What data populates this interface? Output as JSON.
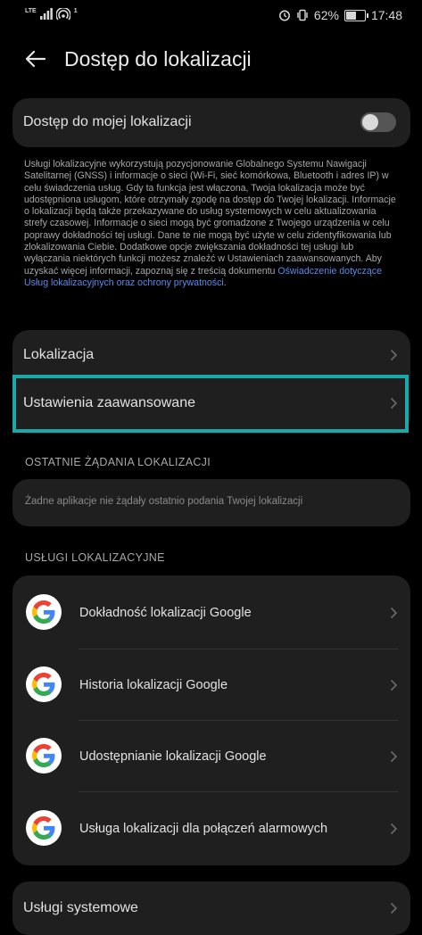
{
  "status": {
    "network": "LTE",
    "signal_sub": "1",
    "battery": "62%",
    "battery_level": 0.62,
    "time": "17:48"
  },
  "header": {
    "title": "Dostęp do lokalizacji"
  },
  "toggle": {
    "label": "Dostęp do mojej lokalizacji",
    "on": false
  },
  "description": {
    "text": "Usługi lokalizacyjne wykorzystują pozycjonowanie Globalnego Systemu Nawigacji Satelitarnej (GNSS) i informacje o sieci (Wi-Fi, sieć komórkowa, Bluetooth i adres IP) w celu świadczenia usług. Gdy ta funkcja jest włączona, Twoja lokalizacja może być udostępniona usługom, które otrzymały zgodę na dostęp do Twojej lokalizacji. Informacje o lokalizacji będą także przekazywane do usług systemowych w celu aktualizowania strefy czasowej. Informacje o sieci mogą być gromadzone z Twojego urządzenia w celu poprawy dokładności tej usługi. Dane te nie mogą być użyte w celu zidentyfikowania lub zlokalizowania Ciebie. Dodatkowe opcje zwiększania dokładności tej usługi lub wyłączania niektórych funkcji możesz znaleźć w Ustawieniach zaawansowanych. Aby uzyskać więcej informacji, zapoznaj się z treścią dokumentu ",
    "link": "Oświadczenie dotyczące Usług lokalizacyjnych oraz ochrony prywatności",
    "end": "."
  },
  "menu": {
    "location": "Lokalizacja",
    "advanced": "Ustawienia zaawansowane"
  },
  "recent": {
    "header": "OSTATNIE ŻĄDANIA LOKALIZACJI",
    "empty": "Żadne aplikacje nie żądały ostatnio podania Twojej lokalizacji"
  },
  "services": {
    "header": "USŁUGI LOKALIZACYJNE",
    "items": [
      {
        "label": "Dokładność lokalizacji Google",
        "icon": "google-icon"
      },
      {
        "label": "Historia lokalizacji Google",
        "icon": "google-icon"
      },
      {
        "label": "Udostępnianie lokalizacji Google",
        "icon": "google-icon"
      },
      {
        "label": "Usługa lokalizacji dla połączeń alarmowych",
        "icon": "google-icon"
      }
    ]
  },
  "system": {
    "label": "Usługi systemowe"
  },
  "colors": {
    "background": "#000000",
    "card": "#1f1f1f",
    "accent_link": "#5b8be8",
    "highlight": "#1aa8a8"
  }
}
